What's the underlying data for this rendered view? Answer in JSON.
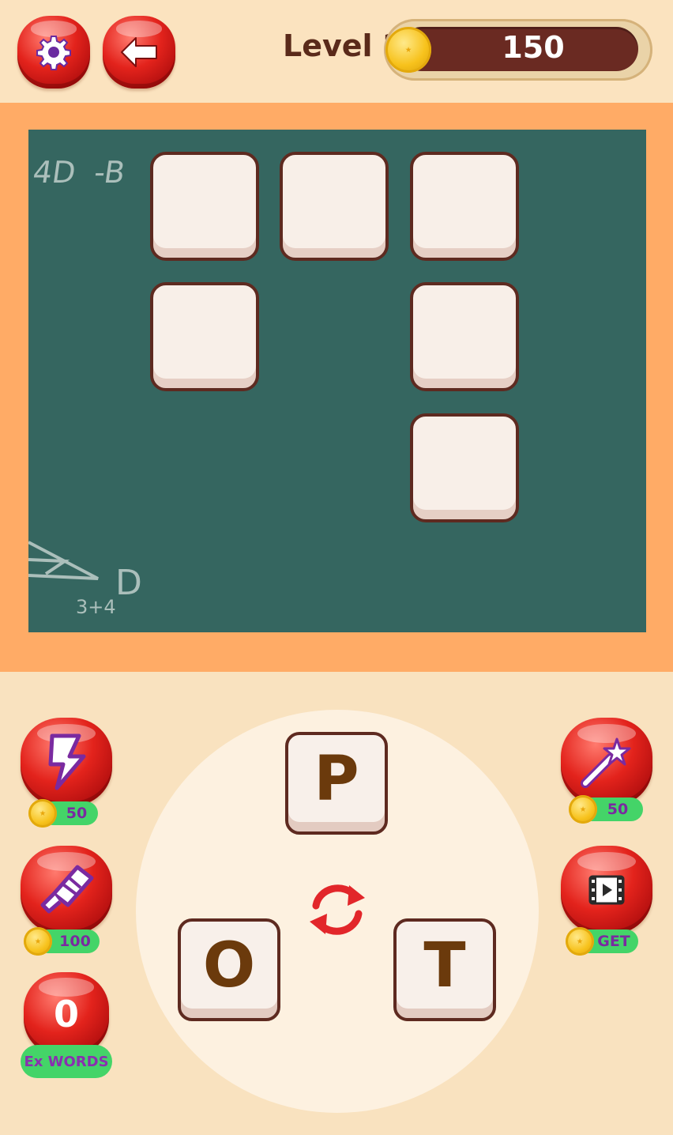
{
  "header": {
    "level_label": "Level 2",
    "coins": "150"
  },
  "board": {
    "chalk_top": "4D  -B",
    "chalk_bottom_letter": "D",
    "chalk_bottom_expr": "3+4",
    "cells_filled": 0,
    "cells_total": 6
  },
  "letters": [
    "P",
    "O",
    "T"
  ],
  "hints": {
    "lightning_price": "50",
    "magic_wand_price": "50",
    "rocket_price": "100",
    "video_label": "GET",
    "extra_words_count": "0",
    "extra_words_label": "Ex WORDS"
  },
  "colors": {
    "button_red": "#e3231c",
    "board_green": "#356660",
    "frame_orange": "#ffab66",
    "pill_green": "#44d468",
    "coinbar_brown": "#6a2a22"
  }
}
